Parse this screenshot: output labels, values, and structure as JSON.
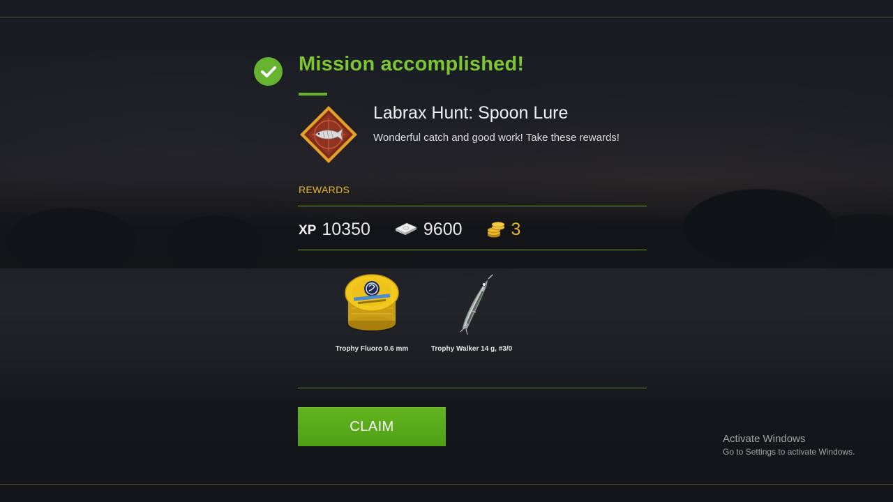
{
  "mission": {
    "status_title": "Mission accomplished!",
    "name": "Labrax Hunt: Spoon Lure",
    "description": "Wonderful catch and good work! Take these rewards!"
  },
  "rewards": {
    "label": "REWARDS",
    "xp_label": "XP",
    "xp": "10350",
    "money": "9600",
    "gold": "3",
    "items": [
      {
        "name": "Trophy Fluoro 0.6 mm",
        "icon": "fishing-line-spool-icon"
      },
      {
        "name": "Trophy Walker 14 g, #3/0",
        "icon": "fishing-lure-icon"
      }
    ]
  },
  "actions": {
    "claim_label": "CLAIM"
  },
  "watermark": {
    "title": "Activate Windows",
    "subtitle": "Go to Settings to activate Windows."
  },
  "colors": {
    "accent_green": "#65b32e",
    "title_green": "#7cc533",
    "gold": "#e8b52c",
    "button_green": "#58aa1a"
  }
}
